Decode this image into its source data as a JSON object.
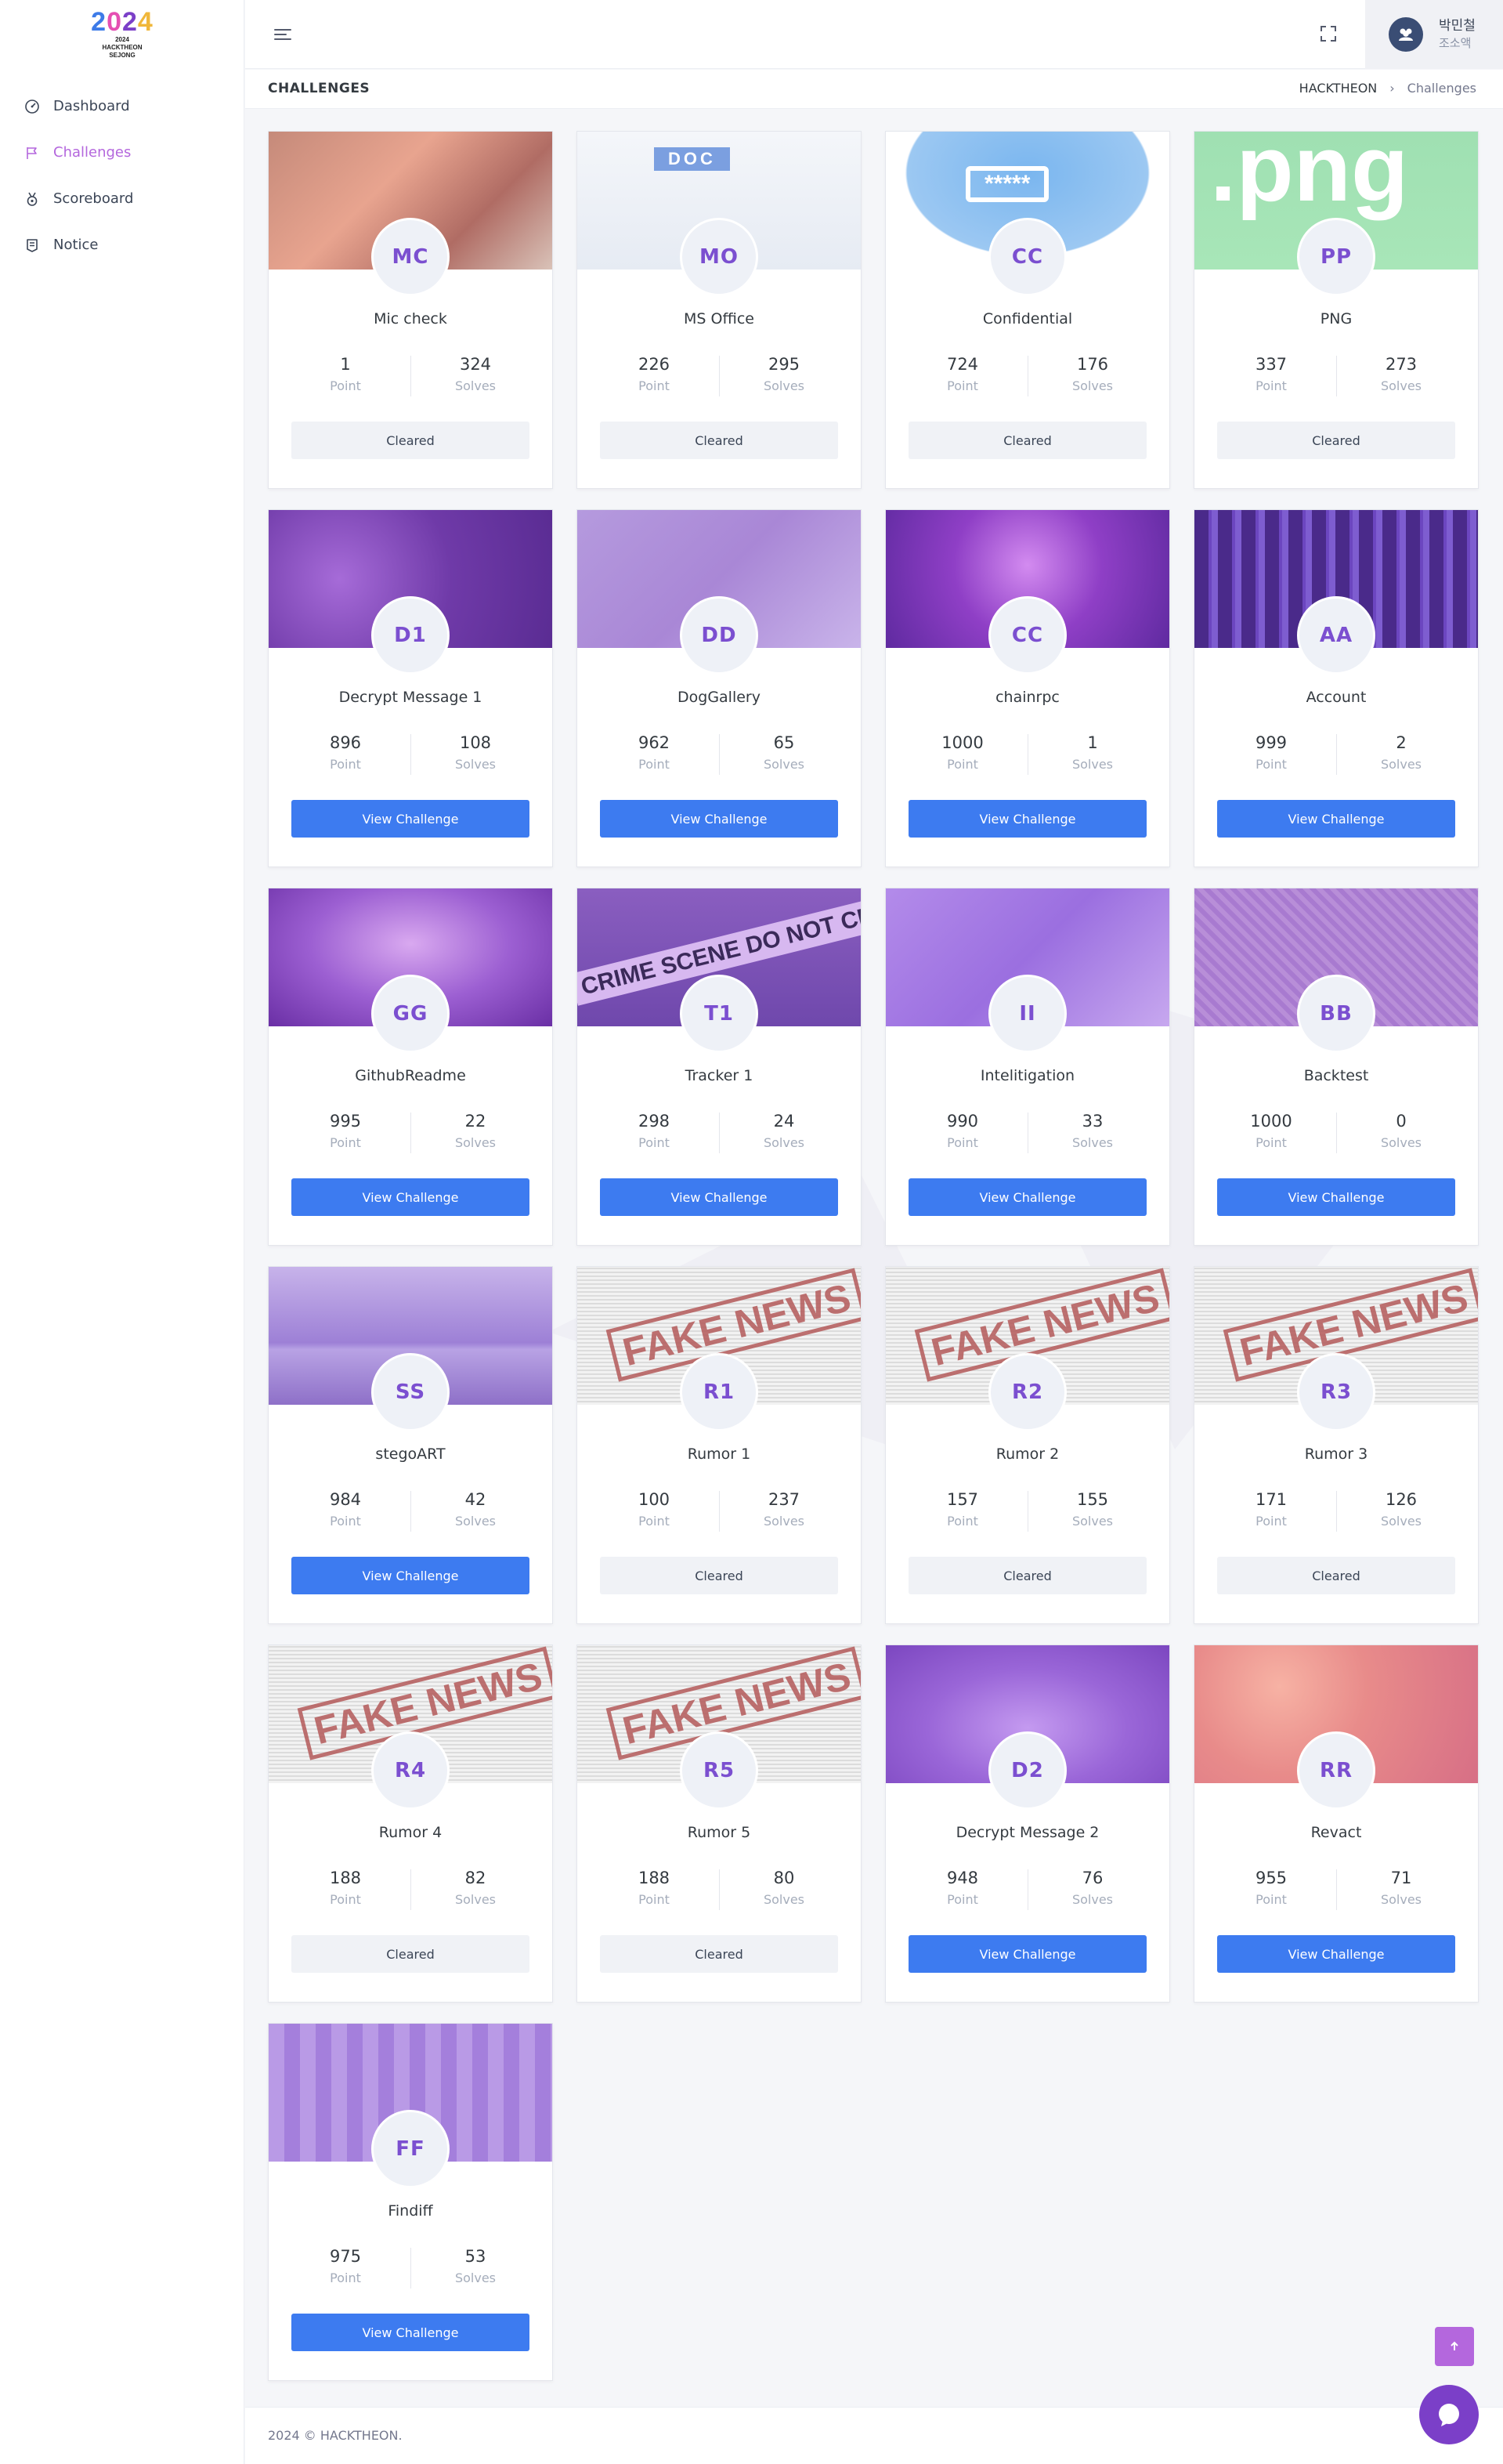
{
  "logo": {
    "year": "2024",
    "line1": "2024",
    "line2": "HACKTHEON",
    "line3": "SEJONG"
  },
  "sidebar": {
    "items": [
      {
        "label": "Dashboard",
        "icon": "dashboard-icon"
      },
      {
        "label": "Challenges",
        "icon": "flag-icon"
      },
      {
        "label": "Scoreboard",
        "icon": "medal-icon"
      },
      {
        "label": "Notice",
        "icon": "notice-icon"
      }
    ],
    "active": "Challenges"
  },
  "topbar": {
    "user_name": "박민철",
    "user_team": "조소액"
  },
  "page": {
    "title": "CHALLENGES"
  },
  "breadcrumb": {
    "root": "HACKTHEON",
    "separator": "›",
    "current": "Challenges"
  },
  "labels": {
    "point": "Point",
    "solves": "Solves"
  },
  "colors": {
    "accent": "#b467dd",
    "primary_button": "#3d7bf0",
    "badge_text": "#7b4fd0"
  },
  "challenges": [
    {
      "initials": "MC",
      "name": "Mic check",
      "point": "1",
      "solves": "324",
      "button": "Cleared",
      "status": "cleared"
    },
    {
      "initials": "MO",
      "name": "MS Office",
      "point": "226",
      "solves": "295",
      "button": "Cleared",
      "status": "cleared",
      "banner_text": "DOC"
    },
    {
      "initials": "CC",
      "name": "Confidential",
      "point": "724",
      "solves": "176",
      "button": "Cleared",
      "status": "cleared",
      "banner_text": "*****"
    },
    {
      "initials": "PP",
      "name": "PNG",
      "point": "337",
      "solves": "273",
      "button": "Cleared",
      "status": "cleared",
      "banner_text": ".png"
    },
    {
      "initials": "D1",
      "name": "Decrypt Message 1",
      "point": "896",
      "solves": "108",
      "button": "View Challenge",
      "status": "open"
    },
    {
      "initials": "DD",
      "name": "DogGallery",
      "point": "962",
      "solves": "65",
      "button": "View Challenge",
      "status": "open"
    },
    {
      "initials": "CC",
      "name": "chainrpc",
      "point": "1000",
      "solves": "1",
      "button": "View Challenge",
      "status": "open"
    },
    {
      "initials": "AA",
      "name": "Account",
      "point": "999",
      "solves": "2",
      "button": "View Challenge",
      "status": "open"
    },
    {
      "initials": "GG",
      "name": "GithubReadme",
      "point": "995",
      "solves": "22",
      "button": "View Challenge",
      "status": "open"
    },
    {
      "initials": "T1",
      "name": "Tracker 1",
      "point": "298",
      "solves": "24",
      "button": "View Challenge",
      "status": "open",
      "banner_text": "CRIME SCENE DO NOT CROSS"
    },
    {
      "initials": "II",
      "name": "Intelitigation",
      "point": "990",
      "solves": "33",
      "button": "View Challenge",
      "status": "open"
    },
    {
      "initials": "BB",
      "name": "Backtest",
      "point": "1000",
      "solves": "0",
      "button": "View Challenge",
      "status": "open"
    },
    {
      "initials": "SS",
      "name": "stegoART",
      "point": "984",
      "solves": "42",
      "button": "View Challenge",
      "status": "open"
    },
    {
      "initials": "R1",
      "name": "Rumor 1",
      "point": "100",
      "solves": "237",
      "button": "Cleared",
      "status": "cleared",
      "banner_text": "FAKE NEWS"
    },
    {
      "initials": "R2",
      "name": "Rumor 2",
      "point": "157",
      "solves": "155",
      "button": "Cleared",
      "status": "cleared",
      "banner_text": "FAKE NEWS"
    },
    {
      "initials": "R3",
      "name": "Rumor 3",
      "point": "171",
      "solves": "126",
      "button": "Cleared",
      "status": "cleared",
      "banner_text": "FAKE NEWS"
    },
    {
      "initials": "R4",
      "name": "Rumor 4",
      "point": "188",
      "solves": "82",
      "button": "Cleared",
      "status": "cleared",
      "banner_text": "FAKE NEWS"
    },
    {
      "initials": "R5",
      "name": "Rumor 5",
      "point": "188",
      "solves": "80",
      "button": "Cleared",
      "status": "cleared",
      "banner_text": "FAKE NEWS"
    },
    {
      "initials": "D2",
      "name": "Decrypt Message 2",
      "point": "948",
      "solves": "76",
      "button": "View Challenge",
      "status": "open"
    },
    {
      "initials": "RR",
      "name": "Revact",
      "point": "955",
      "solves": "71",
      "button": "View Challenge",
      "status": "open"
    },
    {
      "initials": "FF",
      "name": "Findiff",
      "point": "975",
      "solves": "53",
      "button": "View Challenge",
      "status": "open"
    }
  ],
  "footer": {
    "text": "2024 © HACKTHEON."
  }
}
